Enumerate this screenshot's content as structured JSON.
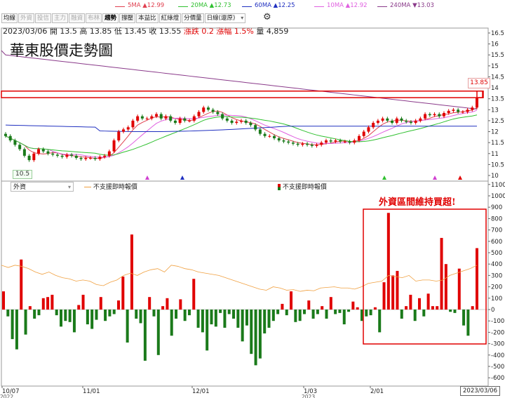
{
  "legend": {
    "ma5": "5MA ▲12.99",
    "ma20": "20MA ▲12.73",
    "ma60": "60MA ▲12.25",
    "ma10": "10MA ▲12.92",
    "ma240": "240MA ▼13.03"
  },
  "toolbar": {
    "items": [
      "均線",
      "外資",
      "投信",
      "主力",
      "融資",
      "布林",
      "趨勢",
      "撐壓",
      "本益比",
      "紅綠燈",
      "分價量"
    ],
    "period_select": "日線(還原)"
  },
  "info": {
    "date": "2023/03/06",
    "open": "開 13.5",
    "high": "高 13.85",
    "low": "低 13.45",
    "close": "收 13.55",
    "change": "漲跌 0.2",
    "change_pct": "漲幅 1.5%",
    "volume": "量 4,859"
  },
  "title": "華東股價走勢圖",
  "lower_select": "外資",
  "lower_legend_line": "不支援即時報價",
  "lower_legend_bar": "不支援即時報價",
  "annotation": "外資區間維持買超!",
  "last_price_tag": "13.85",
  "min_price_tag": "10.5",
  "cursor_date": "2023/03/06",
  "colors": {
    "up": "#e00000",
    "down": "#1a7a1a",
    "ma5": "#e04050",
    "ma10": "#e060e0",
    "ma20": "#30c030",
    "ma60": "#2030c0",
    "ma240": "#8a3a8a",
    "holding": "#f0a040"
  },
  "chart_data": [
    {
      "type": "candlestick",
      "ylim": [
        10,
        16.5
      ],
      "y_ticks": [
        "10",
        "10.5",
        "11",
        "11.5",
        "12",
        "12.5",
        "13",
        "13.5",
        "14",
        "14.5",
        "15",
        "15.5",
        "16",
        "16.5"
      ],
      "x_ticks": [
        "10/07",
        "11/01",
        "12/01",
        "1/03",
        "2/01"
      ],
      "x_tick_years": [
        "2022",
        "2023"
      ],
      "close": [
        11.8,
        11.6,
        11.4,
        11.2,
        10.9,
        10.7,
        11.0,
        11.2,
        11.1,
        11.0,
        10.95,
        10.9,
        10.85,
        10.95,
        10.9,
        10.8,
        10.75,
        10.8,
        10.8,
        10.75,
        10.85,
        10.9,
        11.1,
        11.6,
        12.0,
        12.1,
        12.2,
        12.5,
        12.7,
        12.6,
        12.6,
        12.7,
        12.8,
        12.6,
        12.7,
        12.5,
        12.4,
        12.6,
        12.5,
        12.5,
        12.7,
        12.9,
        13.1,
        13.0,
        12.9,
        12.8,
        12.6,
        12.5,
        12.4,
        12.45,
        12.5,
        12.4,
        12.3,
        12.1,
        11.9,
        11.8,
        11.8,
        11.7,
        11.6,
        11.55,
        11.5,
        11.45,
        11.4,
        11.45,
        11.4,
        11.35,
        11.4,
        11.5,
        11.6,
        11.55,
        11.6,
        11.55,
        11.55,
        11.5,
        11.6,
        11.8,
        12.0,
        12.2,
        12.4,
        12.5,
        12.6,
        12.5,
        12.4,
        12.6,
        12.5,
        12.45,
        12.4,
        12.5,
        12.6,
        12.8,
        12.75,
        12.8,
        12.7,
        12.85,
        12.95,
        13.0,
        12.9,
        12.9,
        13.0,
        13.1,
        13.55
      ],
      "ma_last": {
        "ma5": 12.99,
        "ma10": 12.92,
        "ma20": 12.73,
        "ma60": 12.25,
        "ma240": 13.03
      }
    },
    {
      "type": "bar",
      "ylim": [
        -600,
        1100
      ],
      "y_ticks": [
        "1100",
        "1000",
        "900",
        "800",
        "700",
        "600",
        "500",
        "400",
        "300",
        "200",
        "100",
        "0",
        "-100",
        "-200",
        "-300",
        "-400",
        "-500",
        "-600"
      ],
      "values": [
        160,
        -60,
        -260,
        -350,
        440,
        -220,
        30,
        -80,
        -50,
        100,
        110,
        130,
        -50,
        -150,
        -100,
        -110,
        -200,
        40,
        130,
        -130,
        -170,
        -90,
        110,
        -100,
        -60,
        -40,
        80,
        290,
        -290,
        660,
        -80,
        -120,
        -450,
        110,
        -60,
        -400,
        30,
        100,
        -230,
        -80,
        90,
        -100,
        -50,
        270,
        -160,
        -200,
        -360,
        -130,
        -150,
        -30,
        -160,
        -40,
        -80,
        -160,
        -280,
        -140,
        -390,
        -490,
        -430,
        -210,
        -160,
        -100,
        -40,
        50,
        -50,
        160,
        -110,
        -100,
        -40,
        80,
        -80,
        -40,
        30,
        -80,
        110,
        -40,
        -30,
        -130,
        -20,
        70,
        20,
        -100,
        -60,
        -50,
        20,
        -200,
        240,
        850,
        300,
        340,
        -80,
        30,
        130,
        -100,
        100,
        -60,
        140,
        30,
        30,
        630,
        400,
        -20,
        -30,
        360,
        -140,
        -230,
        30,
        540
      ],
      "holding_line": [
        390,
        370,
        390,
        380,
        360,
        330,
        310,
        330,
        300,
        280,
        270,
        250,
        260,
        250,
        220,
        210,
        240,
        260,
        300,
        320,
        300,
        330,
        350,
        360,
        330,
        390,
        380,
        360,
        350,
        330,
        320,
        310,
        300,
        280,
        260,
        240,
        220,
        200,
        180,
        170,
        200,
        190,
        170,
        175,
        160,
        170,
        165,
        190,
        195,
        200,
        190,
        190,
        180,
        200,
        230,
        240,
        250,
        300,
        290,
        280,
        300,
        250,
        260,
        260,
        250,
        260,
        300,
        320,
        340,
        360,
        390
      ]
    }
  ]
}
